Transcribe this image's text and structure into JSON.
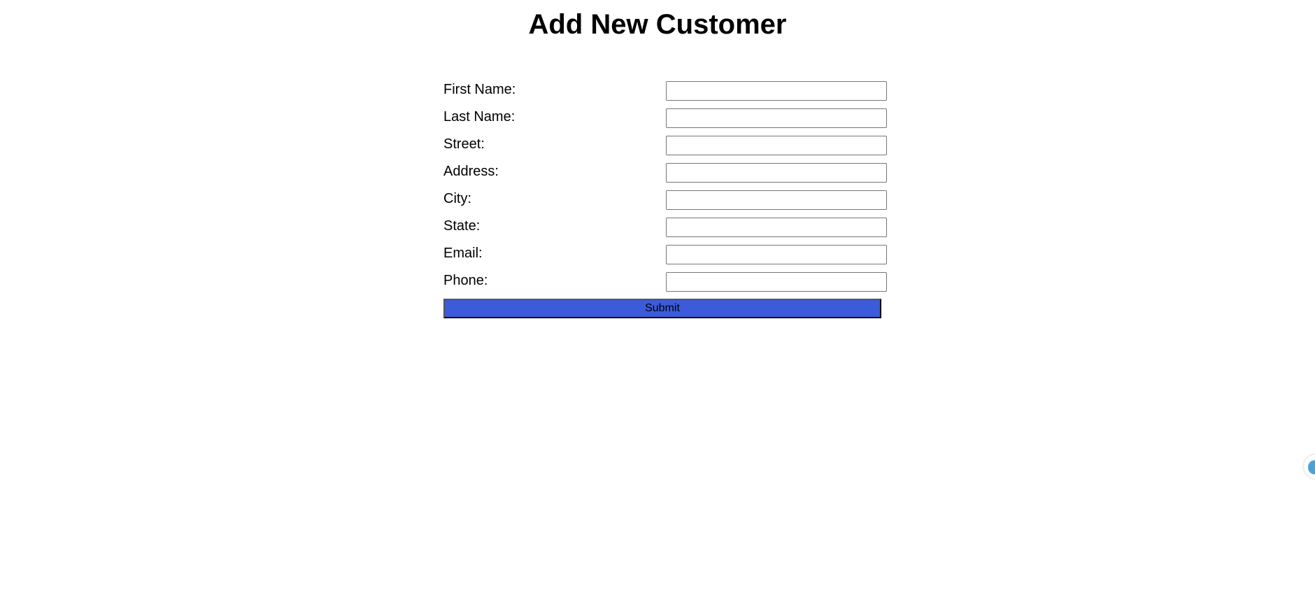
{
  "page": {
    "title": "Add New Customer"
  },
  "form": {
    "fields": [
      {
        "label": "First Name:",
        "value": "",
        "placeholder": ""
      },
      {
        "label": "Last Name:",
        "value": "",
        "placeholder": ""
      },
      {
        "label": "Street:",
        "value": "",
        "placeholder": ""
      },
      {
        "label": "Address:",
        "value": "",
        "placeholder": ""
      },
      {
        "label": "City:",
        "value": "",
        "placeholder": ""
      },
      {
        "label": "State:",
        "value": "",
        "placeholder": ""
      },
      {
        "label": "Email:",
        "value": "",
        "placeholder": ""
      },
      {
        "label": "Phone:",
        "value": "",
        "placeholder": ""
      }
    ],
    "submit_label": "Submit"
  },
  "colors": {
    "submit_background": "#3b5bdb",
    "edge_widget_icon": "#4aa3d8"
  },
  "icons": {
    "edge_widget": "floating-widget-icon"
  }
}
